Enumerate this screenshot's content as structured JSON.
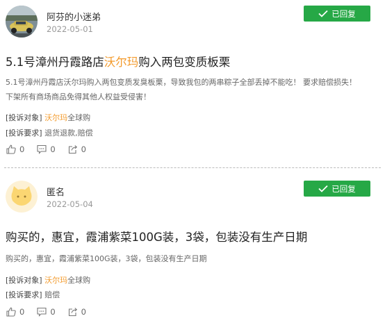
{
  "colors": {
    "accent_green": "#26a846",
    "highlight_orange": "#f39a2b",
    "divider": "#bbbbbb"
  },
  "complaints": [
    {
      "avatar_icon": "car-photo-avatar",
      "username": "阿芬的小迷弟",
      "date": "2022-05-01",
      "status": "已回复",
      "title_prefix": "5.1号漳州丹霞路店",
      "title_highlight": "沃尔玛",
      "title_suffix": "购入两包变质板栗",
      "body_lines": [
        "5.1号漳州丹霞店沃尔玛购入两包变质发臭板栗，导致我包的两串粽子全部丢掉不能吃！ 要求赔偿损失！",
        "下架所有商场商品免得其他人权益受侵害！"
      ],
      "target_label": "[投诉对象]",
      "target_brand": "沃尔玛",
      "target_rest": "全球购",
      "demand_label": "[投诉要求]",
      "demand_value": "退货退款,赔偿",
      "likes": "0",
      "comments": "0",
      "shares": "0"
    },
    {
      "avatar_icon": "cat-face-avatar",
      "username": "匿名",
      "date": "2022-05-04",
      "status": "已回复",
      "title_full": "购买的，惠宜，霞浦紫菜100G装，3袋，包装没有生产日期",
      "body_lines": [
        "购买的，惠宜，霞浦紫菜100G装，3袋，包装没有生产日期"
      ],
      "target_label": "[投诉对象]",
      "target_brand": "沃尔玛",
      "target_rest": "全球购",
      "demand_label": "[投诉要求]",
      "demand_value": "赔偿",
      "likes": "0",
      "comments": "0",
      "shares": "0"
    }
  ]
}
